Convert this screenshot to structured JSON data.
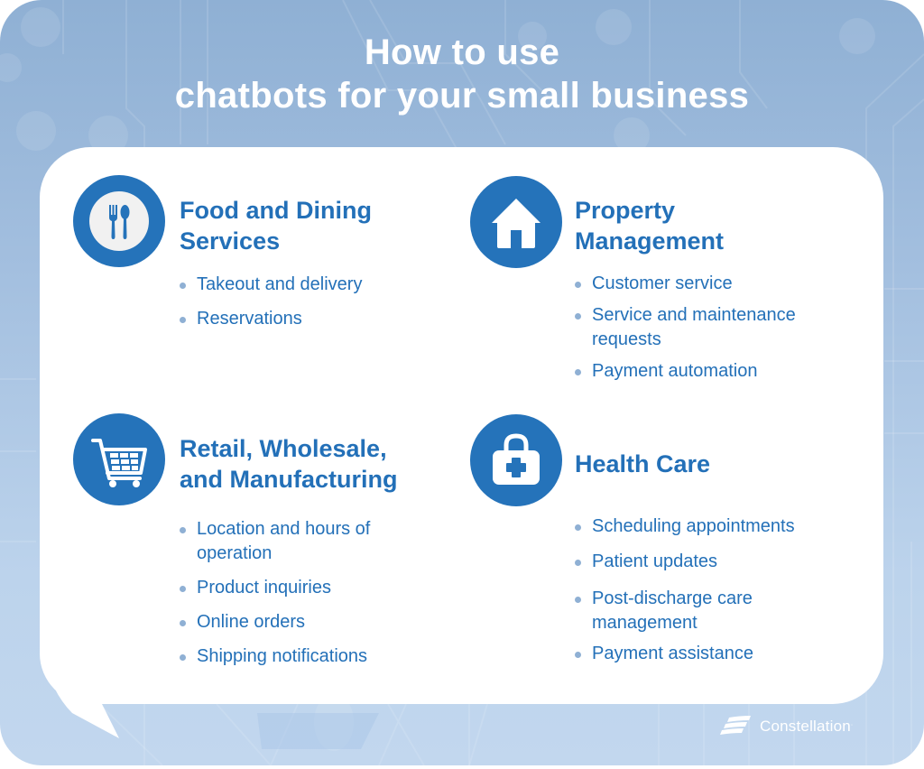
{
  "title": {
    "line1": "How to use",
    "line2": "chatbots for your small business"
  },
  "colors": {
    "accent": "#2573ba",
    "text": "#2370b8",
    "bullet": "#8fb0d4",
    "background_top": "#8fb0d4",
    "background_bottom": "#c2d7ee",
    "card": "#ffffff"
  },
  "sections": [
    {
      "id": "food",
      "icon": "fork-spoon-icon",
      "title_line1": "Food and Dining",
      "title_line2": "Services",
      "items": [
        "Takeout and delivery",
        "Reservations"
      ]
    },
    {
      "id": "property",
      "icon": "house-icon",
      "title_line1": "Property",
      "title_line2": "Management",
      "items": [
        "Customer service",
        "Service and maintenance",
        "requests",
        "Payment automation"
      ]
    },
    {
      "id": "retail",
      "icon": "shopping-cart-icon",
      "title_line1": "Retail, Wholesale,",
      "title_line2": "and Manufacturing",
      "items": [
        "Location and hours of",
        "operation",
        "Product inquiries",
        "Online orders",
        "Shipping notifications"
      ]
    },
    {
      "id": "health",
      "icon": "medical-bag-icon",
      "title_line1": "Health Care",
      "items": [
        "Scheduling appointments",
        "Patient updates",
        "Post-discharge care",
        "management",
        "Payment assistance"
      ]
    }
  ],
  "footer": {
    "logo_icon": "constellation-logo-icon",
    "brand": "Constellation",
    "brand_mark": "."
  }
}
